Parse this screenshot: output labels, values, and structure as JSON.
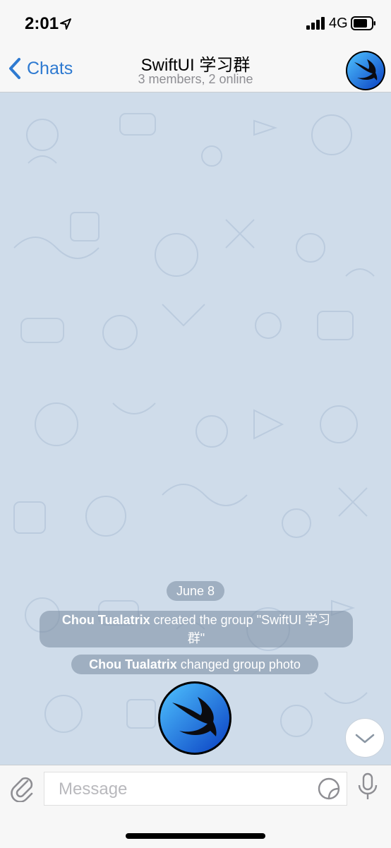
{
  "status_bar": {
    "time": "2:01",
    "network": "4G",
    "icons": [
      "location-arrow-icon",
      "signal-bars-icon",
      "battery-icon"
    ]
  },
  "nav": {
    "back_label": "Chats",
    "title": "SwiftUI 学习群",
    "subtitle": "3 members, 2 online",
    "back_icon": "chevron-left-icon",
    "avatar_icon": "swift-logo-icon"
  },
  "chat": {
    "date": "June 8",
    "events": [
      {
        "actor": "Chou Tualatrix",
        "text_line1": " created the group \"SwiftUI 学习",
        "text_line2": "群\""
      },
      {
        "actor": "Chou Tualatrix",
        "text": " changed group photo"
      }
    ],
    "scroll_icon": "chevron-down-icon"
  },
  "input": {
    "placeholder": "Message",
    "attach_icon": "paperclip-icon",
    "sticker_icon": "sticker-icon",
    "mic_icon": "microphone-icon"
  },
  "colors": {
    "accent": "#2e7ad1",
    "chat_background": "#cfdcea",
    "pill": "#788a9e"
  }
}
